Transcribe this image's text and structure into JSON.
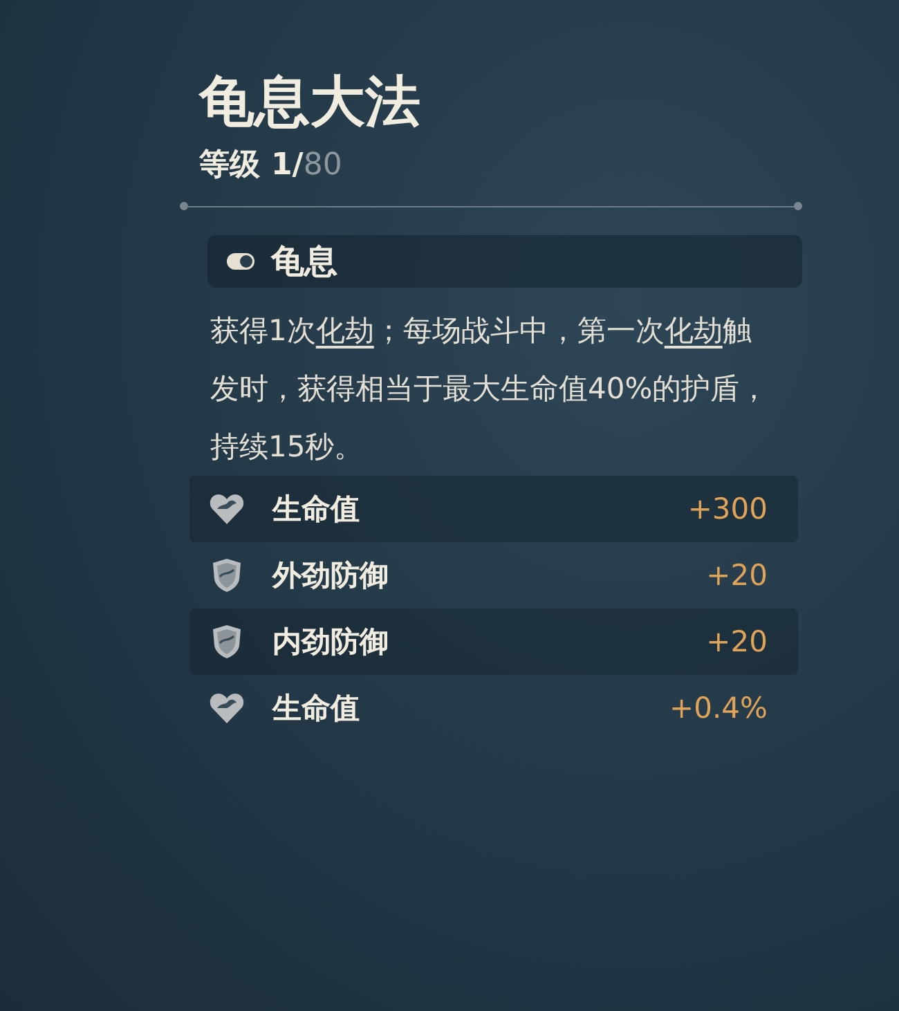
{
  "title": "龟息大法",
  "level": {
    "label": "等级",
    "current": "1/",
    "max": "80"
  },
  "skill": {
    "name": "龟息",
    "description": [
      {
        "kind": "plain",
        "text": "获得1次"
      },
      {
        "kind": "term",
        "text": "化劫"
      },
      {
        "kind": "plain",
        "text": "；每场战斗中，第一次"
      },
      {
        "kind": "term",
        "text": "化劫"
      },
      {
        "kind": "plain",
        "text": "触发时，获得相当于最大生命值40%的护盾，持续15秒。"
      }
    ]
  },
  "stats": [
    {
      "kind": "heart",
      "name": "生命值",
      "value": "+300"
    },
    {
      "kind": "shield",
      "name": "外劲防御",
      "value": "+20"
    },
    {
      "kind": "shield",
      "name": "内劲防御",
      "value": "+20"
    },
    {
      "kind": "heart",
      "name": "生命值",
      "value": "+0.4%"
    }
  ]
}
